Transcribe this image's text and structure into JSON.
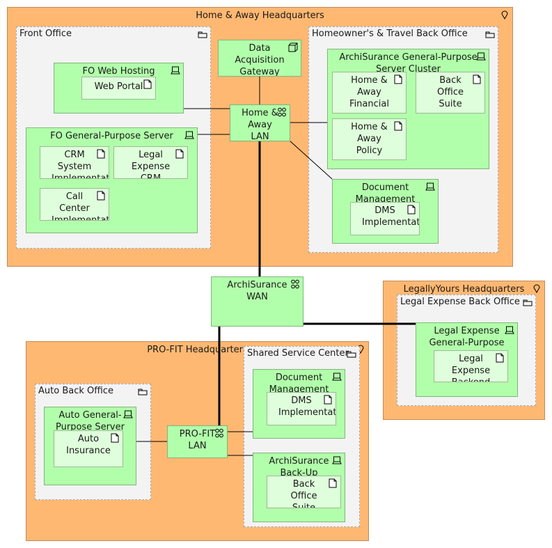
{
  "diagram": {
    "locations": {
      "home_away_hq": "Home & Away Headquarters",
      "legallyyours_hq": "LegallyYours Headquarters",
      "profit_hq": "PRO-FIT Headquarters"
    },
    "groupings": {
      "front_office": "Front Office",
      "ht_back_office": "Homeowner's & Travel Back Office",
      "legal_back_office": "Legal Expense Back Office",
      "auto_back_office": "Auto Back Office",
      "shared_service_center": "Shared Service Center"
    },
    "nodes": {
      "fo_web_hosting": "FO Web Hosting",
      "fo_gp_server": "FO General-Purpose Server",
      "data_acq_gateway": "Data Acquisition Gateway",
      "ha_lan": "Home & Away LAN",
      "gp_cluster": "ArchiSurance General-Purpose Server Cluster",
      "doc_mgmt_ha": "Document Management Server",
      "wan": "ArchiSurance WAN",
      "le_gp_server": "Legal Expense General-Purpose Server",
      "auto_gp": "Auto General-Purpose Server",
      "profit_lan": "PRO-FIT LAN",
      "doc_mgmt_ssc": "Document Management Server",
      "backup_server": "ArchiSurance Back-Up Server"
    },
    "artifacts": {
      "web_portal": "Web Portal",
      "crm_system": "CRM System Implementation",
      "legal_crm": "Legal Expense CRM",
      "call_center": "Call Center Implementation",
      "ha_financial": "Home & Away Financial",
      "back_office_suite_1": "Back Office Suite",
      "ha_policy": "Home & Away Policy",
      "dms_impl_1": "DMS Implementation",
      "legal_backend": "Legal Expense Backend",
      "auto_insurance": "Auto Insurance",
      "dms_impl_2": "DMS Implementation",
      "back_office_suite_2": "Back Office Suite"
    },
    "icons": {
      "location": "location-pin-icon",
      "grouping": "folder-icon",
      "node": "device-icon",
      "artifact": "document-icon",
      "network": "network-icon",
      "gateway": "cube-node-icon"
    },
    "colors": {
      "location": "#ffb872",
      "grouping": "#f3f3f3",
      "node": "#b2ffab",
      "artifact": "#dffedb"
    }
  }
}
